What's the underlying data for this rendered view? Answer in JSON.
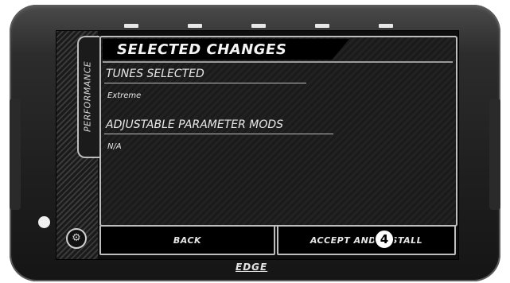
{
  "side_tab_label": "PERFORMANCE",
  "header": {
    "title": "SELECTED CHANGES"
  },
  "sections": [
    {
      "heading": "TUNES SELECTED",
      "value": "Extreme"
    },
    {
      "heading": "ADJUSTABLE PARAMETER MODS",
      "value": "N/A"
    }
  ],
  "buttons": {
    "back_label": "BACK",
    "accept_label": "ACCEPT AND INSTALL"
  },
  "callout_number": "4",
  "brand": "EDGE",
  "settings_icon": "gear-icon",
  "colors": {
    "screen_bg": "#0d0d0d",
    "border": "#bdbdbd",
    "text": "#e8e8e8"
  }
}
